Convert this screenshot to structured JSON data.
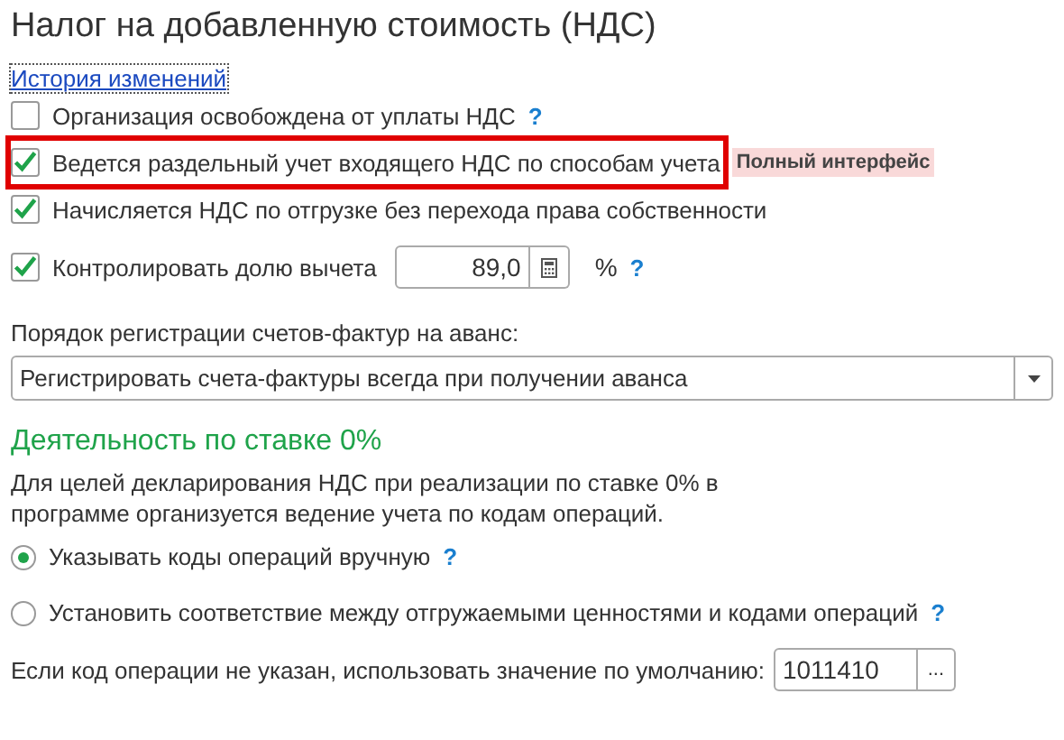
{
  "title": "Налог на добавленную стоимость (НДС)",
  "history_link": "История изменений",
  "options": [
    {
      "kind": "checkbox",
      "label": "Организация освобождена от уплаты НДС",
      "checked": false,
      "highlighted": false,
      "help": "?"
    },
    {
      "kind": "checkbox",
      "label": "Ведется раздельный учет входящего НДС по способам учета",
      "checked": true,
      "highlighted": true,
      "badge": "Полный интерфейс"
    },
    {
      "kind": "checkbox",
      "label": "Начисляется НДС по отгрузке без перехода права собственности",
      "checked": true,
      "highlighted": false
    },
    {
      "kind": "percent",
      "label": "Контролировать долю вычета",
      "checked": true,
      "highlighted": false,
      "value": "89,0",
      "unit": "%",
      "help": "?"
    }
  ],
  "advance": {
    "label": "Порядок регистрации счетов-фактур на аванс:",
    "value": "Регистрировать счета-фактуры всегда при получении аванса"
  },
  "zero_rate": {
    "heading": "Деятельность по ставке 0%",
    "description": "Для целей декларирования НДС при реализации по ставке 0% в программе организуется ведение учета по кодам операций.",
    "radios": [
      {
        "label": "Указывать коды операций вручную",
        "selected": true,
        "help": "?"
      },
      {
        "label": "Установить соответствие между отгружаемыми ценностями и кодами операций",
        "selected": false,
        "help": "?"
      }
    ],
    "default_code": {
      "label": "Если код операции не указан, использовать значение по умолчанию:",
      "value": "1011410",
      "button": "..."
    }
  }
}
